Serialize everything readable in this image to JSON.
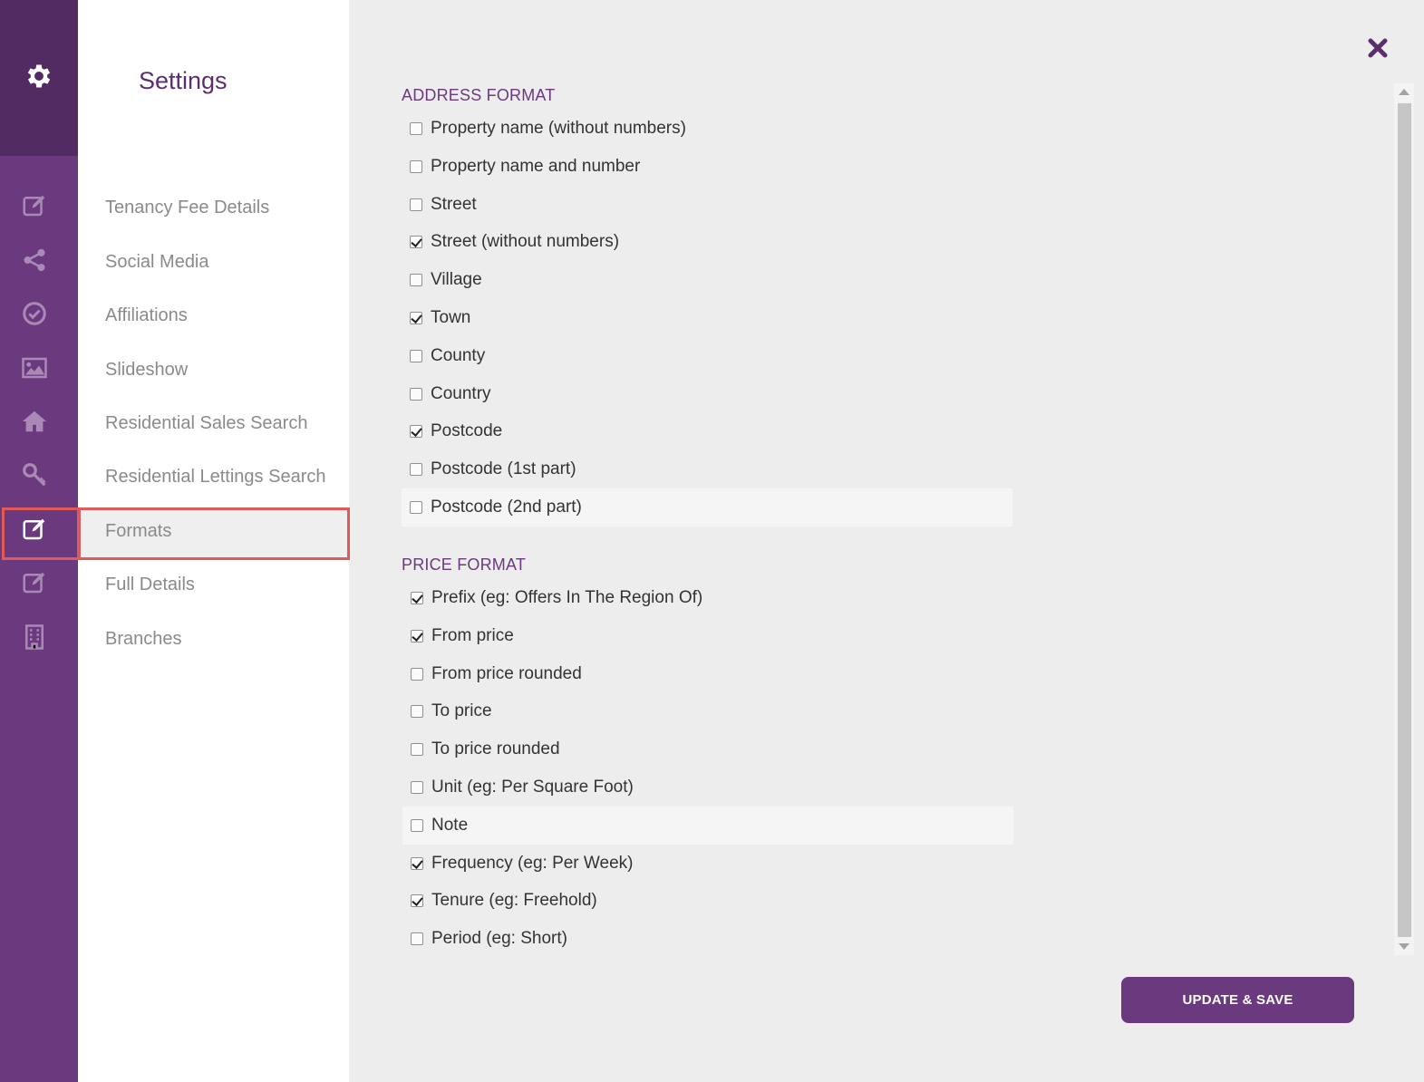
{
  "panel": {
    "title": "Settings",
    "menu": [
      {
        "label": "Tenancy Fee Details"
      },
      {
        "label": "Social Media"
      },
      {
        "label": "Affiliations"
      },
      {
        "label": "Slideshow"
      },
      {
        "label": "Residential Sales Search"
      },
      {
        "label": "Residential Lettings Search"
      },
      {
        "label": "Formats",
        "active": true
      },
      {
        "label": "Full Details"
      },
      {
        "label": "Branches"
      }
    ]
  },
  "rail_icons": [
    "gear-icon",
    "edit-icon",
    "share-icon",
    "check-circle-icon",
    "image-icon",
    "home-icon",
    "key-icon",
    "edit-icon",
    "edit-icon",
    "building-icon"
  ],
  "address_format": {
    "title": "ADDRESS FORMAT",
    "options": [
      {
        "label": "Property name (without numbers)",
        "checked": false
      },
      {
        "label": "Property name and number",
        "checked": false
      },
      {
        "label": "Street",
        "checked": false
      },
      {
        "label": "Street (without numbers)",
        "checked": true
      },
      {
        "label": "Village",
        "checked": false
      },
      {
        "label": "Town",
        "checked": true
      },
      {
        "label": "County",
        "checked": false
      },
      {
        "label": "Country",
        "checked": false
      },
      {
        "label": "Postcode",
        "checked": true
      },
      {
        "label": "Postcode (1st part)",
        "checked": false
      },
      {
        "label": "Postcode (2nd part)",
        "checked": false
      }
    ]
  },
  "price_format": {
    "title": "PRICE FORMAT",
    "options": [
      {
        "label": "Prefix (eg: Offers In The Region Of)",
        "checked": true
      },
      {
        "label": "From price",
        "checked": true
      },
      {
        "label": "From price rounded",
        "checked": false
      },
      {
        "label": "To price",
        "checked": false
      },
      {
        "label": "To price rounded",
        "checked": false
      },
      {
        "label": "Unit (eg: Per Square Foot)",
        "checked": false
      },
      {
        "label": "Note",
        "checked": false
      },
      {
        "label": "Frequency (eg: Per Week)",
        "checked": true
      },
      {
        "label": "Tenure (eg: Freehold)",
        "checked": true
      },
      {
        "label": "Period (eg: Short)",
        "checked": false
      }
    ]
  },
  "actions": {
    "save_label": "UPDATE & SAVE"
  },
  "colors": {
    "brand": "#6b3a7e",
    "brand_dark": "#512b62",
    "highlight": "#e05a5a"
  }
}
